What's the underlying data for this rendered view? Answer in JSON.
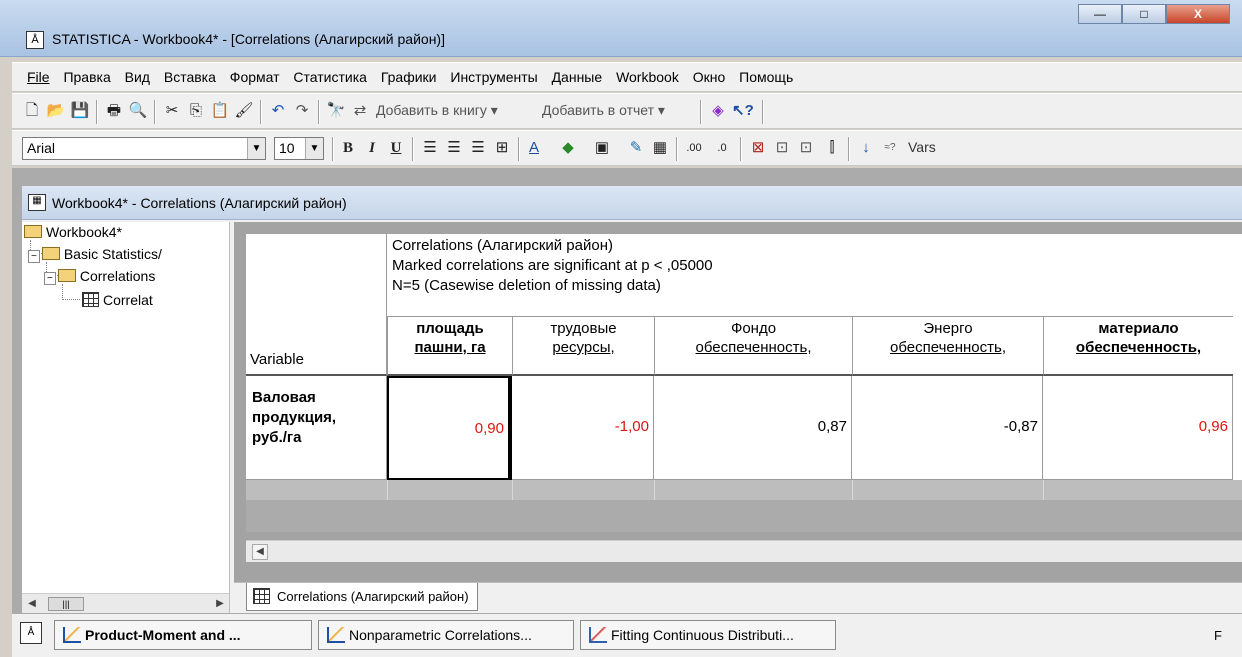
{
  "window": {
    "title": "STATISTICA - Workbook4* - [Correlations (Алагирский район)]",
    "buttons": {
      "minimize": "—",
      "maximize": "□",
      "close": "X"
    }
  },
  "menu": [
    "File",
    "Правка",
    "Вид",
    "Вставка",
    "Формат",
    "Статистика",
    "Графики",
    "Инструменты",
    "Данные",
    "Workbook",
    "Окно",
    "Помощь"
  ],
  "toolbar1": {
    "add_to_workbook": "Добавить в книгу ▾",
    "add_to_report": "Добавить в отчет ▾"
  },
  "toolbar2": {
    "font": "Arial",
    "size": "10",
    "bold": "B",
    "italic": "I",
    "underline": "U",
    "vars": "Vars"
  },
  "child_window": {
    "title": "Workbook4* - Correlations (Алагирский район)"
  },
  "tree": {
    "root": "Workbook4*",
    "level1": "Basic Statistics/",
    "level2": "Correlations",
    "level3": "Correlat"
  },
  "sheet": {
    "header_lines": [
      "Correlations (Алагирский район)",
      "Marked correlations are significant at p < ,05000",
      "N=5 (Casewise deletion of missing data)"
    ],
    "row_header_label": "Variable",
    "columns": [
      {
        "line1": "площадь",
        "line2": "пашни, га"
      },
      {
        "line1": "трудовые",
        "line2": "ресурсы,"
      },
      {
        "line1": "Фондо",
        "line2": "обеспеченность,"
      },
      {
        "line1": "Энерго",
        "line2": "обеспеченность,"
      },
      {
        "line1": "материало",
        "line2": "обеспеченность,"
      }
    ],
    "row_label_lines": [
      "Валовая",
      "продукция,",
      "руб./га"
    ],
    "values": [
      "0,90",
      "-1,00",
      "0,87",
      "-0,87",
      "0,96"
    ]
  },
  "sheet_tab": "Correlations (Алагирский район)",
  "taskbar": {
    "tasks": [
      "Product-Moment and ...",
      "Nonparametric Correlations...",
      "Fitting Continuous Distributi..."
    ],
    "status": "F"
  },
  "colors": {
    "significant": "#e0140f",
    "title_gradient": "#a9c3e3"
  }
}
